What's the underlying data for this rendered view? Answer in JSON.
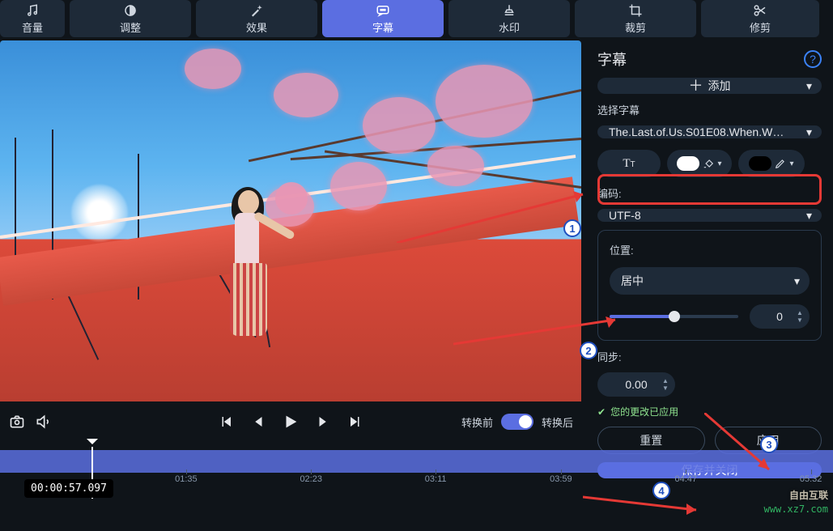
{
  "tabs": [
    {
      "id": "volume",
      "label": "音量"
    },
    {
      "id": "adjust",
      "label": "调整"
    },
    {
      "id": "effects",
      "label": "效果"
    },
    {
      "id": "subtitle",
      "label": "字幕"
    },
    {
      "id": "watermark",
      "label": "水印"
    },
    {
      "id": "crop",
      "label": "裁剪"
    },
    {
      "id": "trim",
      "label": "修剪"
    }
  ],
  "active_tab": "subtitle",
  "panel": {
    "title": "字幕",
    "add_label": "添加",
    "select_label": "选择字幕",
    "selected_file": "The.Last.of.Us.S01E08.When.W…",
    "encoding_label": "编码:",
    "encoding_value": "UTF-8",
    "position_label": "位置:",
    "position_value": "居中",
    "position_offset": "0",
    "sync_label": "同步:",
    "sync_value": "0.00",
    "status_text": "您的更改已应用",
    "reset_label": "重置",
    "apply_label": "应用",
    "save_close_label": "保存并关闭",
    "text_size_button": "Tᴛ",
    "fill_color": "#ffffff",
    "outline_color": "#000000"
  },
  "transport": {
    "before_label": "转换前",
    "after_label": "转换后",
    "toggle_after": true
  },
  "timeline": {
    "current": "00:00:57.097",
    "ticks": [
      "01:35",
      "02:23",
      "03:11",
      "03:59",
      "04:47",
      "05:32"
    ],
    "playhead_pct": 11
  },
  "annotations": {
    "badges": [
      "1",
      "2",
      "3",
      "4"
    ]
  },
  "watermark": {
    "line1": "自由互联",
    "line2": "www.xz7.com"
  }
}
